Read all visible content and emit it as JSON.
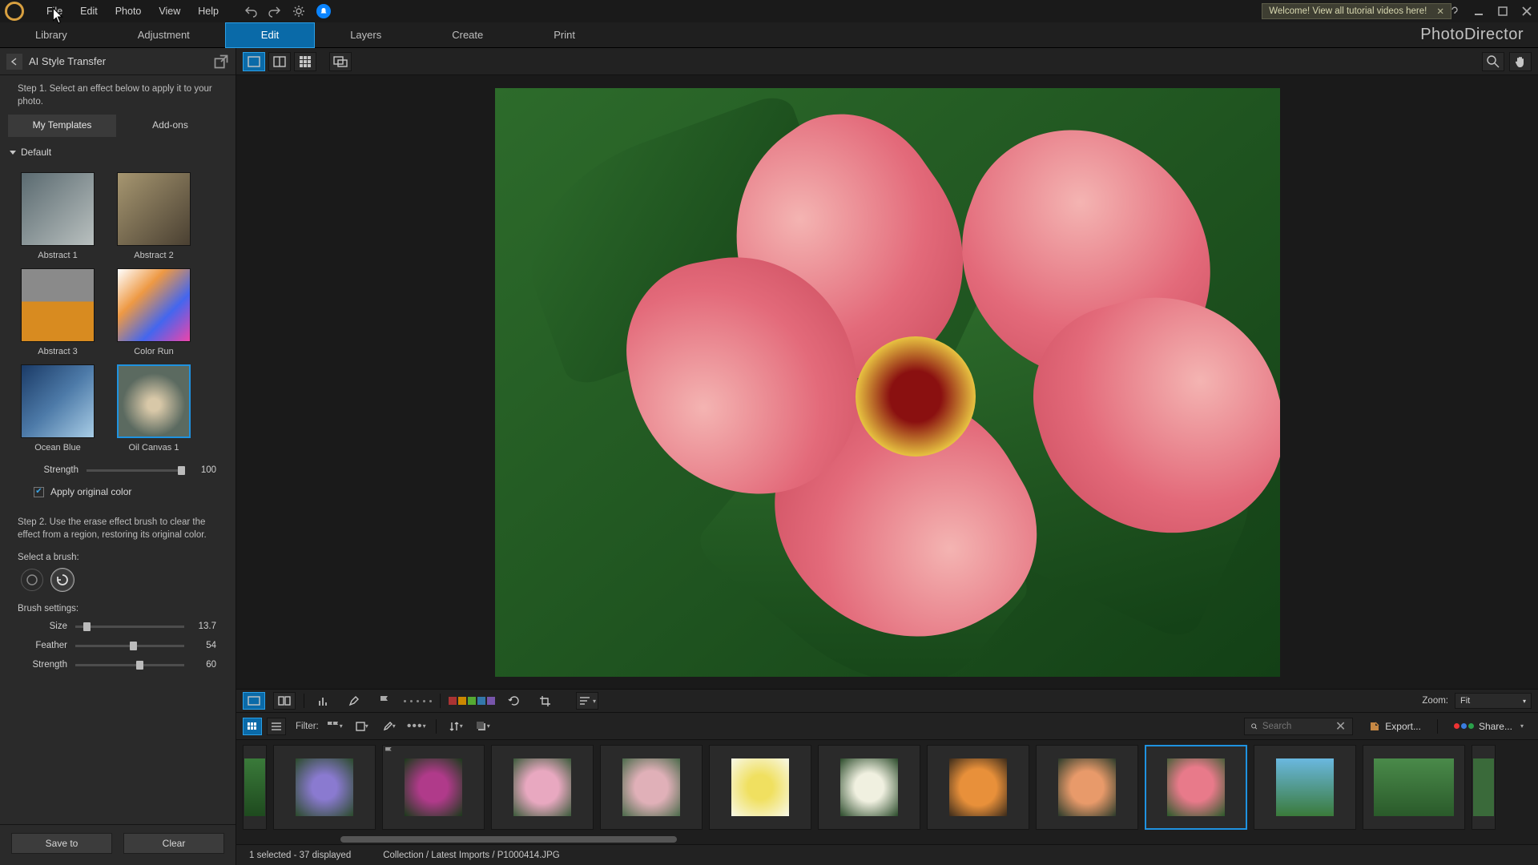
{
  "menubar": {
    "items": [
      "File",
      "Edit",
      "Photo",
      "View",
      "Help"
    ]
  },
  "tutorial_banner": {
    "text": "Welcome! View all tutorial videos here!"
  },
  "module_tabs": {
    "items": [
      "Library",
      "Adjustment",
      "Edit",
      "Layers",
      "Create",
      "Print"
    ],
    "active": "Edit"
  },
  "product_name": "PhotoDirector",
  "panel": {
    "title": "AI Style Transfer",
    "step1": "Step 1. Select an effect below to apply it to your photo.",
    "sub_tabs": [
      "My Templates",
      "Add-ons"
    ],
    "active_sub": "My Templates",
    "section": "Default",
    "thumbs": [
      {
        "label": "Abstract 1"
      },
      {
        "label": "Abstract 2"
      },
      {
        "label": "Abstract 3"
      },
      {
        "label": "Color Run"
      },
      {
        "label": "Ocean Blue"
      },
      {
        "label": "Oil Canvas 1"
      }
    ],
    "selected_thumb": 5,
    "strength_label": "Strength",
    "strength_value": "100",
    "apply_original": "Apply original color",
    "step2": "Step 2. Use the erase effect brush to clear the effect from a region, restoring its original color.",
    "select_brush": "Select a brush:",
    "brush_settings": "Brush settings:",
    "size_label": "Size",
    "size_val": "13.7",
    "feather_label": "Feather",
    "feather_val": "54",
    "strength2_label": "Strength",
    "strength2_val": "60",
    "save_to": "Save to",
    "clear": "Clear"
  },
  "lower_bar": {
    "zoom_label": "Zoom:",
    "zoom_value": "Fit"
  },
  "strip_head": {
    "filter": "Filter:",
    "search_placeholder": "Search",
    "export": "Export...",
    "share": "Share..."
  },
  "status": {
    "selection": "1 selected - 37 displayed",
    "breadcrumb": "Collection / Latest Imports / P1000414.JPG"
  }
}
